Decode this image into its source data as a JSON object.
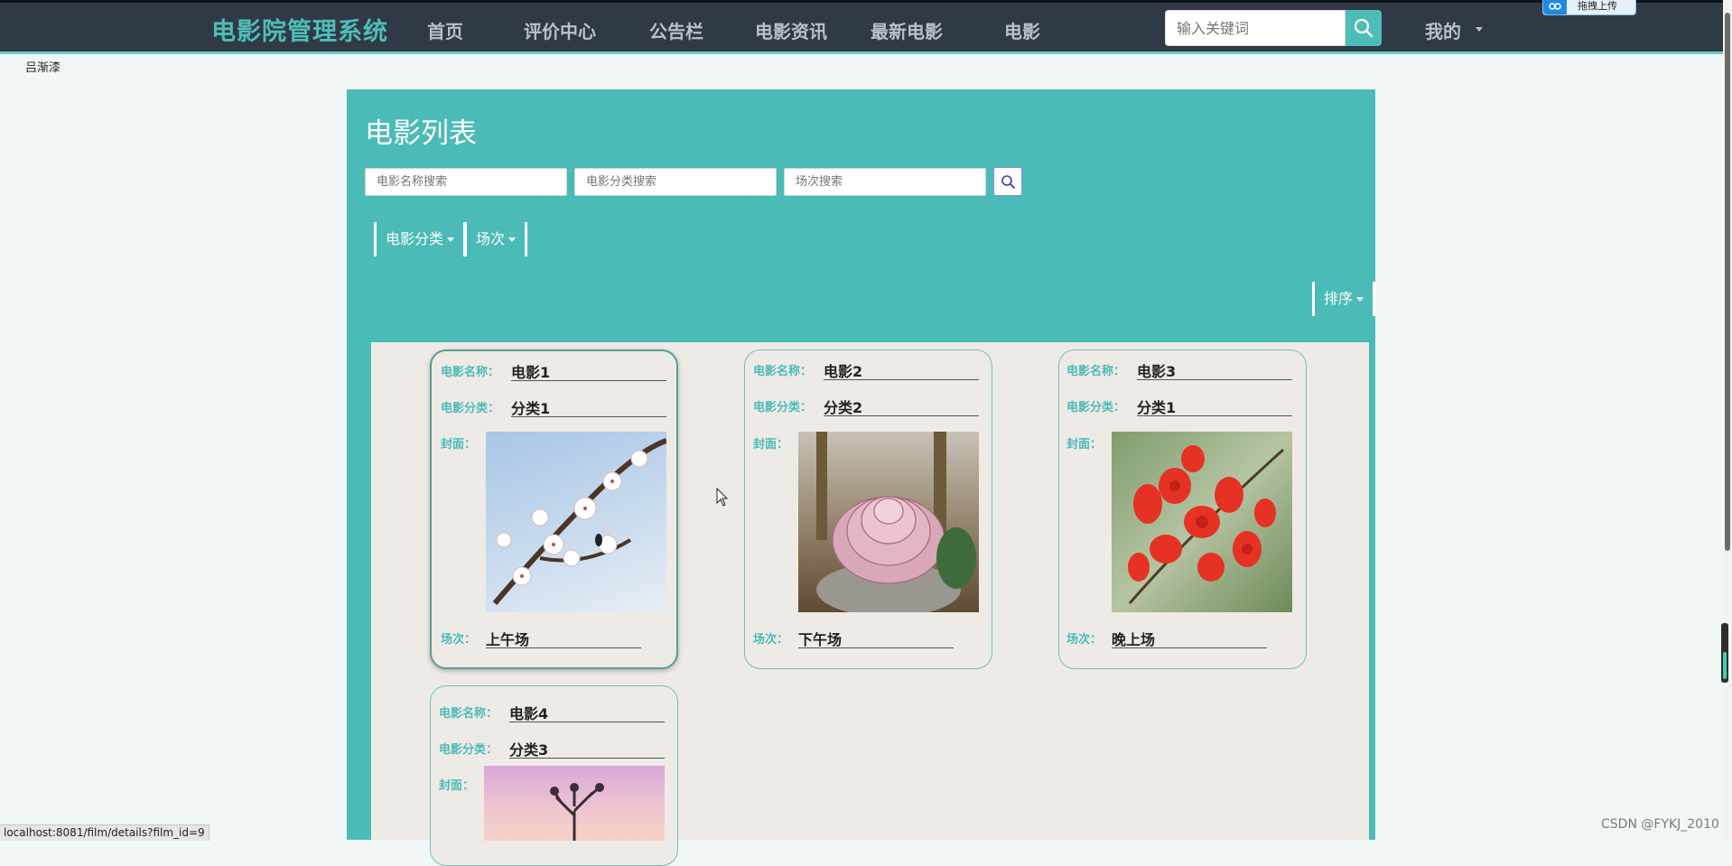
{
  "nav": {
    "brand": "电影院管理系统",
    "items": [
      "首页",
      "评价中心",
      "公告栏",
      "电影资讯",
      "最新电影",
      "电影"
    ],
    "search_placeholder": "输入关键词",
    "user_menu": "我的"
  },
  "upload_badge": "拖拽上传",
  "corner_text": "吕渐漆",
  "panel": {
    "title": "电影列表",
    "filters": {
      "name_placeholder": "电影名称搜索",
      "category_placeholder": "电影分类搜索",
      "session_placeholder": "场次搜索"
    },
    "dropdowns": [
      "电影分类",
      "场次"
    ],
    "sort_label": "排序"
  },
  "card_labels": {
    "name": "电影名称：",
    "category": "电影分类：",
    "cover": "封面：",
    "session": "场次："
  },
  "films": [
    {
      "name": "电影1",
      "category": "分类1",
      "session": "上午场",
      "cover": "plum-blossom-image"
    },
    {
      "name": "电影2",
      "category": "分类2",
      "session": "下午场",
      "cover": "succulent-image"
    },
    {
      "name": "电影3",
      "category": "分类1",
      "session": "晚上场",
      "cover": "red-flowers-image"
    },
    {
      "name": "电影4",
      "category": "分类3",
      "session": "",
      "cover": "tree-sunset-image"
    }
  ],
  "status_url": "localhost:8081/film/details?film_id=9",
  "watermark": "CSDN @FYKJ_2010",
  "colors": {
    "accent": "#4bbbb7",
    "nav_bg": "#2f3a46",
    "card_bg": "#eeeae6"
  }
}
